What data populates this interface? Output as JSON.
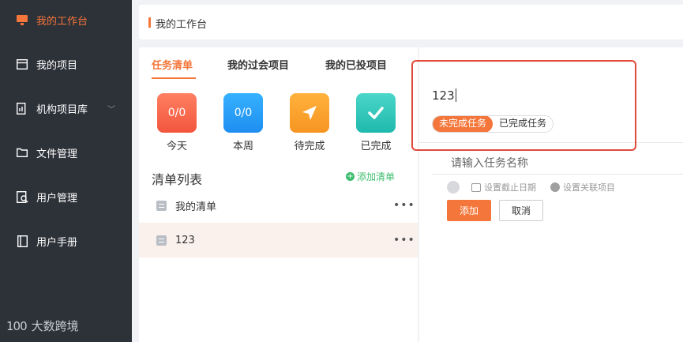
{
  "sidebar": {
    "items": [
      {
        "label": "我的工作台",
        "icon": "monitor-icon",
        "active": true
      },
      {
        "label": "我的项目",
        "icon": "project-box-icon"
      },
      {
        "label": "机构项目库",
        "icon": "chart-document-icon",
        "has_children": true
      },
      {
        "label": "文件管理",
        "icon": "folder-icon"
      },
      {
        "label": "用户管理",
        "icon": "user-search-icon"
      },
      {
        "label": "用户手册",
        "icon": "book-icon"
      }
    ],
    "watermark_text": "大数跨境",
    "watermark_mark": "100"
  },
  "header": {
    "title": "我的工作台"
  },
  "tabs": [
    {
      "label": "任务清单",
      "active": true
    },
    {
      "label": "我的过会项目"
    },
    {
      "label": "我的已投项目"
    }
  ],
  "stats": [
    {
      "value": "0/0",
      "label": "今天",
      "color": "#f2563d"
    },
    {
      "value": "0/0",
      "label": "本周",
      "color": "#1e8ef0"
    },
    {
      "value": "",
      "label": "待完成",
      "icon": "send-arrow-icon",
      "color": "#f79421"
    },
    {
      "value": "",
      "label": "已完成",
      "icon": "check-icon",
      "color": "#1fb9ad"
    }
  ],
  "list_section": {
    "title": "清单列表",
    "add_label": "添加清单",
    "items": [
      {
        "name": "我的清单",
        "more": "•••"
      },
      {
        "name": "123",
        "more": "•••",
        "selected": true
      }
    ]
  },
  "task_panel": {
    "list_name": "123",
    "filter": {
      "active": "未完成任务",
      "inactive": "已完成任务"
    },
    "name_placeholder": "请输入任务名称",
    "set_deadline": "设置截止日期",
    "set_project": "设置关联项目",
    "add_button": "添加",
    "cancel_button": "取消"
  },
  "colors": {
    "accent": "#f4763a",
    "sidebar_bg": "#2d3138",
    "highlight_box": "#e04a3a",
    "green": "#3dbd6d"
  }
}
